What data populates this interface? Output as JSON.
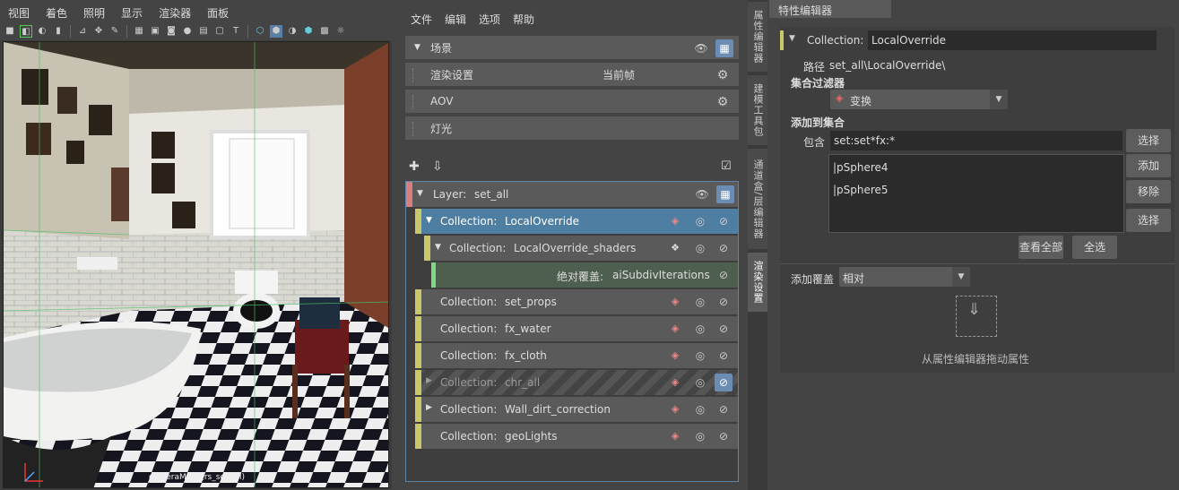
{
  "viewport": {
    "menu": [
      "视图",
      "着色",
      "照明",
      "显示",
      "渲染器",
      "面板"
    ],
    "camera_label": "cameraMain (rs_set_all)"
  },
  "render_setup": {
    "menu": [
      "文件",
      "编辑",
      "选项",
      "帮助"
    ],
    "sections": [
      {
        "label": "场景"
      },
      {
        "label": "渲染设置",
        "value": "当前帧"
      },
      {
        "label": "AOV"
      },
      {
        "label": "灯光"
      }
    ],
    "tree": [
      {
        "prefix": "Layer:",
        "name": "set_all",
        "color": "#d77f7f"
      },
      {
        "prefix": "Collection:",
        "name": "LocalOverride",
        "color": "#c9c76a"
      },
      {
        "prefix": "Collection:",
        "name": "LocalOverride_shaders",
        "color": "#c9c76a"
      },
      {
        "prefix": "绝对覆盖:",
        "name": "aiSubdivIterations",
        "color": "#7fd77f"
      },
      {
        "prefix": "Collection:",
        "name": "set_props",
        "color": "#c9c76a"
      },
      {
        "prefix": "Collection:",
        "name": "fx_water",
        "color": "#c9c76a"
      },
      {
        "prefix": "Collection:",
        "name": "fx_cloth",
        "color": "#c9c76a"
      },
      {
        "prefix": "Collection:",
        "name": "chr_all",
        "color": "#c9c76a"
      },
      {
        "prefix": "Collection:",
        "name": "Wall_dirt_correction",
        "color": "#c9c76a"
      },
      {
        "prefix": "Collection:",
        "name": "geoLights",
        "color": "#c9c76a"
      }
    ]
  },
  "side_tabs": [
    "属性编辑器",
    "建模工具包",
    "通道盒/层编辑器",
    "渲染设置"
  ],
  "attribute_editor": {
    "tab": "特性编辑器",
    "collection_label": "Collection:",
    "collection_name": "LocalOverride",
    "path_label": "路径",
    "path_value": "set_all\\LocalOverride\\",
    "filter_label": "集合过滤器",
    "filter_value": "变换",
    "add_to_collection_label": "添加到集合",
    "include_label": "包含",
    "include_value": "set:set*fx:*",
    "members": [
      "|pSphere4",
      "|pSphere5"
    ],
    "btn_select": "选择",
    "btn_add": "添加",
    "btn_remove": "移除",
    "btn_select2": "选择",
    "btn_view_all": "查看全部",
    "btn_select_all": "全选",
    "add_override_label": "添加覆盖",
    "add_override_value": "相对",
    "drop_hint": "从属性编辑器拖动属性"
  }
}
